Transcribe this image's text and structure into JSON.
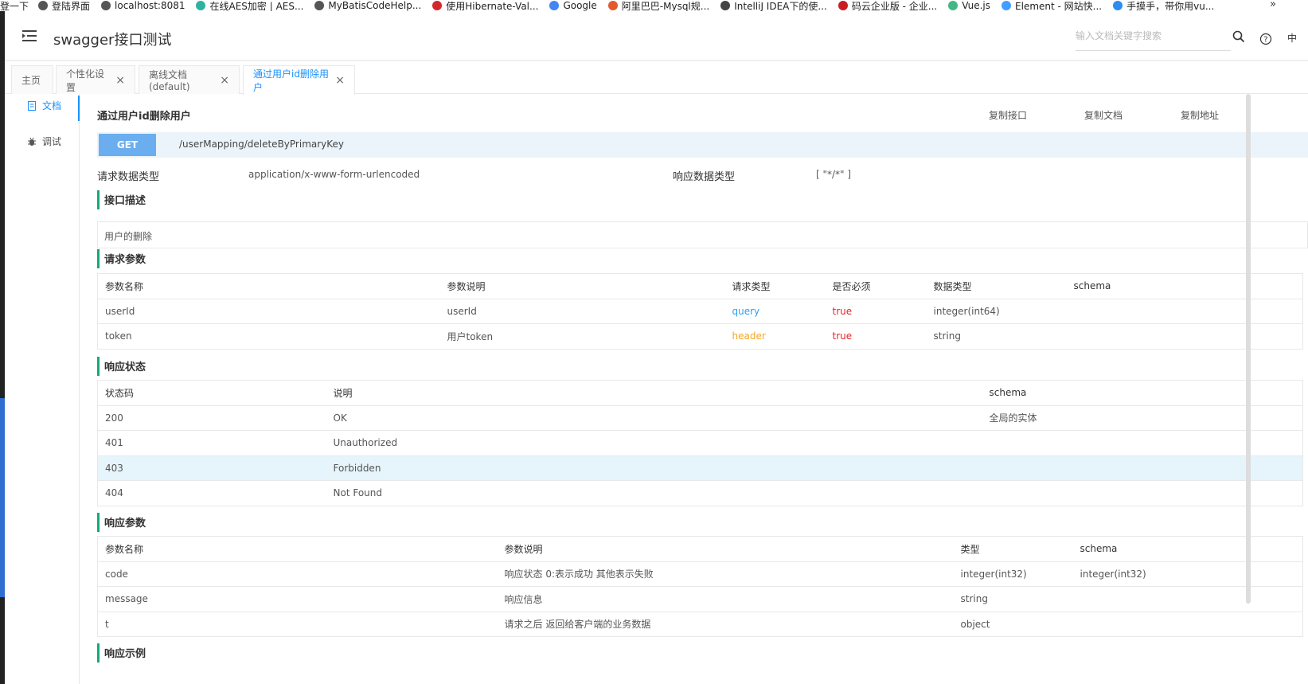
{
  "bookmarks": [
    {
      "label": "登陆界面",
      "color": "#555"
    },
    {
      "label": "localhost:8081",
      "color": "#555"
    },
    {
      "label": "在线AES加密 | AES...",
      "color": "#2fb3a0"
    },
    {
      "label": "MyBatisCodeHelp...",
      "color": "#555"
    },
    {
      "label": "使用Hibernate-Val...",
      "color": "#d4272d"
    },
    {
      "label": "Google",
      "color": "#4285f4"
    },
    {
      "label": "阿里巴巴-Mysql规...",
      "color": "#e25a2c"
    },
    {
      "label": "IntelliJ IDEA下的使...",
      "color": "#444"
    },
    {
      "label": "码云企业版 - 企业...",
      "color": "#c71d23"
    },
    {
      "label": "Vue.js",
      "color": "#41b883"
    },
    {
      "label": "Element - 网站快...",
      "color": "#409eff"
    },
    {
      "label": "手摸手，带你用vu...",
      "color": "#2d8cf0"
    }
  ],
  "bookmarks_prefix": "登一下",
  "bookmarks_more": "»",
  "header": {
    "title": "swagger接口测试",
    "search_placeholder": "输入文档关键字搜索",
    "lang": "中"
  },
  "tabs": [
    {
      "label": "主页",
      "closable": false
    },
    {
      "label": "个性化设置",
      "closable": true
    },
    {
      "label": "离线文档(default)",
      "closable": true
    },
    {
      "label": "通过用户id删除用户",
      "closable": true,
      "active": true
    }
  ],
  "sidenav": {
    "doc": "文档",
    "debug": "调试"
  },
  "api": {
    "title": "通过用户id删除用户",
    "copy_api": "复制接口",
    "copy_doc": "复制文档",
    "copy_url": "复制地址",
    "method": "GET",
    "path": "/userMapping/deleteByPrimaryKey",
    "req_type_label": "请求数据类型",
    "req_type_value": "application/x-www-form-urlencoded",
    "resp_type_label": "响应数据类型",
    "resp_type_value": "[ \"*/*\" ]"
  },
  "sections": {
    "desc": "接口描述",
    "desc_text": "用户的删除",
    "req_params": "请求参数",
    "resp_status": "响应状态",
    "resp_params": "响应参数",
    "resp_example": "响应示例"
  },
  "req_params": {
    "headers": [
      "参数名称",
      "参数说明",
      "请求类型",
      "是否必须",
      "数据类型",
      "schema"
    ],
    "rows": [
      [
        "userId",
        "userId",
        "query",
        "true",
        "integer(int64)",
        ""
      ],
      [
        "token",
        "用户token",
        "header",
        "true",
        "string",
        ""
      ]
    ]
  },
  "resp_status": {
    "headers": [
      "状态码",
      "说明",
      "schema"
    ],
    "rows": [
      [
        "200",
        "OK",
        "全局的实体"
      ],
      [
        "401",
        "Unauthorized",
        ""
      ],
      [
        "403",
        "Forbidden",
        ""
      ],
      [
        "404",
        "Not Found",
        ""
      ]
    ]
  },
  "resp_params": {
    "headers": [
      "参数名称",
      "参数说明",
      "类型",
      "schema"
    ],
    "rows": [
      [
        "code",
        "响应状态 0:表示成功 其他表示失败",
        "integer(int32)",
        "integer(int32)"
      ],
      [
        "message",
        "响应信息",
        "string",
        ""
      ],
      [
        "t",
        "请求之后 返回给客户端的业务数据",
        "object",
        ""
      ]
    ]
  },
  "colors": {
    "accent": "#1890ff",
    "method_get": "#6aaef0",
    "section_bar": "#13ab76",
    "query": "#2d9ff5",
    "header": "#f5a623",
    "required": "#e5242b"
  }
}
